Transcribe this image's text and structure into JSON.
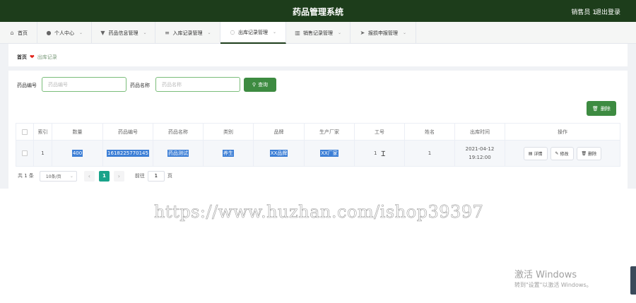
{
  "header": {
    "title": "药品管理系统",
    "user": "销售员 1",
    "logout": "退出登录"
  },
  "nav": [
    {
      "label": "首页",
      "icon": "home-icon",
      "has_dropdown": false
    },
    {
      "label": "个人中心",
      "icon": "user-icon",
      "has_dropdown": true
    },
    {
      "label": "药品信息管理",
      "icon": "pill-icon",
      "has_dropdown": true
    },
    {
      "label": "入库记录管理",
      "icon": "list-icon",
      "has_dropdown": true
    },
    {
      "label": "出库记录管理",
      "icon": "bulb-icon",
      "has_dropdown": true
    },
    {
      "label": "销售记录管理",
      "icon": "chart-icon",
      "has_dropdown": true
    },
    {
      "label": "报损申报管理",
      "icon": "send-icon",
      "has_dropdown": true
    }
  ],
  "active_nav": "出库记录管理",
  "breadcrumb": {
    "home": "首页",
    "current": "出库记录"
  },
  "search": {
    "code_label": "药品编号",
    "code_placeholder": "药品编号",
    "name_label": "药品名称",
    "name_placeholder": "药品名称",
    "query_button": "查询"
  },
  "toolbar": {
    "delete_label": "删除"
  },
  "table": {
    "headers": [
      "",
      "索引",
      "数量",
      "药品编号",
      "药品名称",
      "类别",
      "品牌",
      "生产厂家",
      "工号",
      "姓名",
      "出库时间",
      "操作"
    ],
    "rows": [
      {
        "index": "1",
        "quantity": "400",
        "code": "1618225770145",
        "name": "药品测试",
        "category": "养生",
        "brand": "XX品牌",
        "manufacturer": "XX厂家",
        "staff_no": "1",
        "staff_name": "1",
        "time": "2021-04-12 19:12:00",
        "actions": [
          "详情",
          "修改",
          "删除"
        ]
      }
    ]
  },
  "pagination": {
    "total": "共 1 条",
    "page_size": "10条/页",
    "current_page": "1",
    "goto_label": "前往",
    "goto_value": "1",
    "page_unit": "页"
  },
  "watermark": {
    "url": "https://www.huzhan.com/ishop39397",
    "activate_title": "激活 Windows",
    "activate_sub": "转到\"设置\"以激活 Windows。"
  },
  "colors": {
    "header_bg": "#1d3d1b",
    "primary_green": "#3d8b41",
    "page_active": "#19a38a",
    "selection_blue": "#3d7fd6"
  }
}
